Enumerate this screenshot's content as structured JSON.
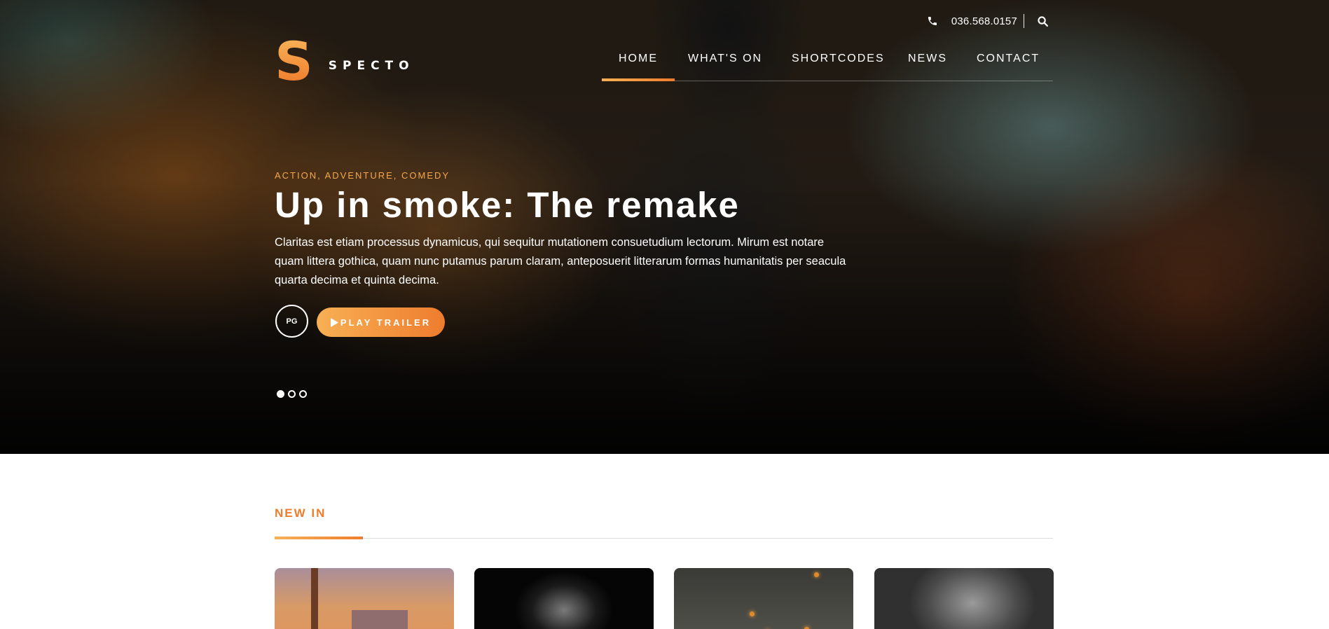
{
  "header": {
    "phone": "036.568.0157",
    "logo_mark": "S",
    "logo_text": "SPECTO",
    "nav": [
      {
        "label": "HOME",
        "active": true
      },
      {
        "label": "WHAT'S ON",
        "active": false
      },
      {
        "label": "SHORTCODES",
        "active": false
      },
      {
        "label": "NEWS",
        "active": false
      },
      {
        "label": "CONTACT",
        "active": false
      }
    ],
    "icons": {
      "phone": "phone-icon",
      "search": "search-icon"
    }
  },
  "hero": {
    "genres": "ACTION, ADVENTURE, COMEDY",
    "title": "Up in smoke: The remake",
    "description": "Claritas est etiam processus dynamicus, qui sequitur mutationem consuetudium lectorum. Mirum est notare quam littera gothica, quam nunc putamus parum claram, anteposuerit litterarum formas humanitatis per seacula quarta decima et quinta decima.",
    "rating": "PG",
    "trailer_button": "PLAY TRAILER",
    "slides": 3,
    "active_slide": 1
  },
  "new_in": {
    "title": "NEW IN",
    "cards": 4
  },
  "colors": {
    "accent_start": "#f8b054",
    "accent_end": "#ee7d2e",
    "section_title": "#ee7d2e",
    "genres": "#f6a74b"
  }
}
